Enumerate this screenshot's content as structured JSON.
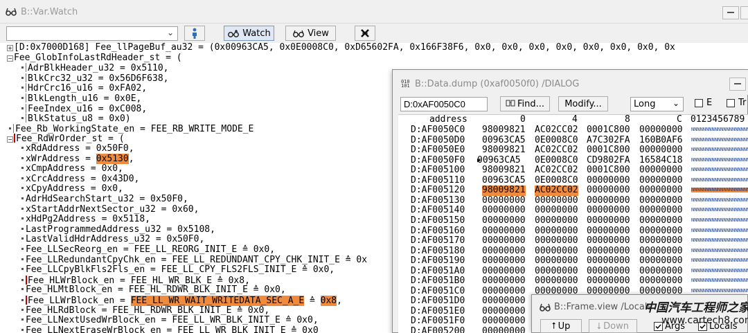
{
  "watch": {
    "title": "B::Var.Watch",
    "buttons": {
      "watch": "Watch",
      "view": "View"
    },
    "lines": [
      "[D:0x7000D168] Fee_llPageBuf_au32 = (0x00963CA5, 0x0E0008C0, 0xD65602FA, 0x166F38F6, 0x0, 0x0, 0x0, 0x0, 0x0, 0x0, 0x0, 0x",
      "Fee_GlobInfoLastRdHeader_st = (",
      "AdrBlkHeader_u32 = 0x5110,",
      "BlkCrc32_u32 = 0x56D6F638,",
      "HdrCrc16_u16 = 0xFA02,",
      "BlkLength_u16 = 0x0E,",
      "FeeIndex_u16 = 0xC008,",
      "BlkStatus_u8 = 0x0)",
      "Fee_Rb_WorkingState_en = FEE_RB_WRITE_MODE_E",
      "Fee_RdWrOrder_st = (",
      "xRdAddress = 0x50F0,",
      "xWrAddress = ",
      "xCmpAddress = 0x0,",
      "xCrcAddress = 0x43D0,",
      "xCpyAddress = 0x0,",
      "AdrHdSearchStart_u32 = 0x50F0,",
      "xStartAddrNextSector_u32 = 0x60,",
      "xHdPg2Address = 0x5118,",
      "LastProgrammedAddress_u32 = 0x5108,",
      "LastValidHdrAddress_u32 = 0x50F0,",
      "Fee_LLSecReorg_en = FEE_LL_REORG_INIT_E ≙ 0x0,",
      "Fee_LLRedundantCpyChk_en = FEE_LL_REDUNDANT_CPY_CHK_INIT_E ≙ 0x",
      "Fee_LLCpyBlkFls2Fls_en = FEE_LL_CPY_FLS2FLS_INIT_E ≙ 0x0,",
      "Fee_HLWrBlock_en = FEE_HL_WR_BLK_E ≙ 0x8,",
      "Fee_HLMtBlock_en = FEE_HL_RDWR_BLK_INIT_E ≙ 0x0,",
      "Fee_LLWrBlock_en = ",
      "Fee_HLRdBlock = FEE_HL_RDWR_BLK_INIT_E ≙ 0x0,",
      "Fee_LLNextUsedWrBlock_en = FEE_LL_WR_BLK_INIT_E ≙ 0x0,",
      "Fee_LLNextEraseWrBlock_en = FEE_LL_WR_BLK_INIT_E ≙ 0x0"
    ],
    "hl_wr_address": "0x5130",
    "hl_wr_address_tail": ",",
    "hl_llwrblock": "FEE_LL_WR_WAIT_WRITEDATA_SEC_A_E",
    "hl_llwrblock_mid": " ≙ ",
    "hl_llwrblock_val": "0x8",
    "hl_llwrblock_tail": ","
  },
  "dump": {
    "title": "B::Data.dump (0xaf0050f0) /DIALOG",
    "address_input": "D:0xAF0050C0",
    "find_label": "Find...",
    "modify_label": "Modify...",
    "format": "Long",
    "check_e": "E",
    "check_tr": "Tr",
    "head_address": "address",
    "head_cols": [
      "0",
      "4",
      "8",
      "C"
    ],
    "head_ascii": "0123456789",
    "rows": [
      {
        "addr": "D:AF0050C0",
        "c0": "98009821",
        "c1": "AC02CC02",
        "c2": "0001C800",
        "c3": "00000000"
      },
      {
        "addr": "D:AF0050D0",
        "c0": "00963CA5",
        "c1": "0E0008C0",
        "c2": "A7C302FA",
        "c3": "160B0AF6"
      },
      {
        "addr": "D:AF0050E0",
        "c0": "98009821",
        "c1": "AC02CC02",
        "c2": "0001C800",
        "c3": "00000000"
      },
      {
        "addr": "D:AF0050F0",
        "c0": "00963CA5",
        "c1": "0E0008C0",
        "c2": "CD9802FA",
        "c3": "16584C18"
      },
      {
        "addr": "D:AF005100",
        "c0": "98009821",
        "c1": "AC02CC02",
        "c2": "0001C800",
        "c3": "00000000"
      },
      {
        "addr": "D:AF005110",
        "c0": "00963CA5",
        "c1": "0E0008C0",
        "c2": "00000000",
        "c3": "00000000"
      },
      {
        "addr": "D:AF005120",
        "c0": "98009821",
        "c1": "AC02CC02",
        "c2": "00000000",
        "c3": "00000000"
      },
      {
        "addr": "D:AF005130",
        "c0": "00000000",
        "c1": "00000000",
        "c2": "00000000",
        "c3": "00000000"
      },
      {
        "addr": "D:AF005140",
        "c0": "00000000",
        "c1": "00000000",
        "c2": "00000000",
        "c3": "00000000"
      },
      {
        "addr": "D:AF005150",
        "c0": "00000000",
        "c1": "00000000",
        "c2": "00000000",
        "c3": "00000000"
      },
      {
        "addr": "D:AF005160",
        "c0": "00000000",
        "c1": "00000000",
        "c2": "00000000",
        "c3": "00000000"
      },
      {
        "addr": "D:AF005170",
        "c0": "00000000",
        "c1": "00000000",
        "c2": "00000000",
        "c3": "00000000"
      },
      {
        "addr": "D:AF005180",
        "c0": "00000000",
        "c1": "00000000",
        "c2": "00000000",
        "c3": "00000000"
      },
      {
        "addr": "D:AF005190",
        "c0": "00000000",
        "c1": "00000000",
        "c2": "00000000",
        "c3": "00000000"
      },
      {
        "addr": "D:AF0051A0",
        "c0": "00000000",
        "c1": "00000000",
        "c2": "00000000",
        "c3": "00000000"
      },
      {
        "addr": "D:AF0051B0",
        "c0": "00000000",
        "c1": "00000000",
        "c2": "00000000",
        "c3": "00000000"
      },
      {
        "addr": "D:AF0051C0",
        "c0": "00000000",
        "c1": "00000000",
        "c2": "00000000",
        "c3": "00000000"
      },
      {
        "addr": "D:AF0051D0",
        "c0": "00000000",
        "c1": "",
        "c2": "",
        "c3": ""
      },
      {
        "addr": "D:AF0051E0",
        "c0": "00000000",
        "c1": "",
        "c2": "",
        "c3": ""
      },
      {
        "addr": "D:AF0051F0",
        "c0": "00000000",
        "c1": "",
        "c2": "",
        "c3": ""
      },
      {
        "addr": "D:AF005200",
        "c0": "00000000",
        "c1": "",
        "c2": "",
        "c3": ""
      }
    ],
    "highlight_row_index": 6,
    "ascii_filler": "NNNNNNNNNNNNNNNNNNNN"
  },
  "frame": {
    "title": "B::Frame.view /Locals",
    "up_label": "Up",
    "down_label": "Down",
    "args_label": "Args",
    "locals_label": "Locals"
  },
  "watermark": {
    "text": "中国汽车工程师之家",
    "url": "www.cartech8.com"
  },
  "colors": {
    "highlight": "#f08a3c",
    "red_marker": "#c00000"
  }
}
